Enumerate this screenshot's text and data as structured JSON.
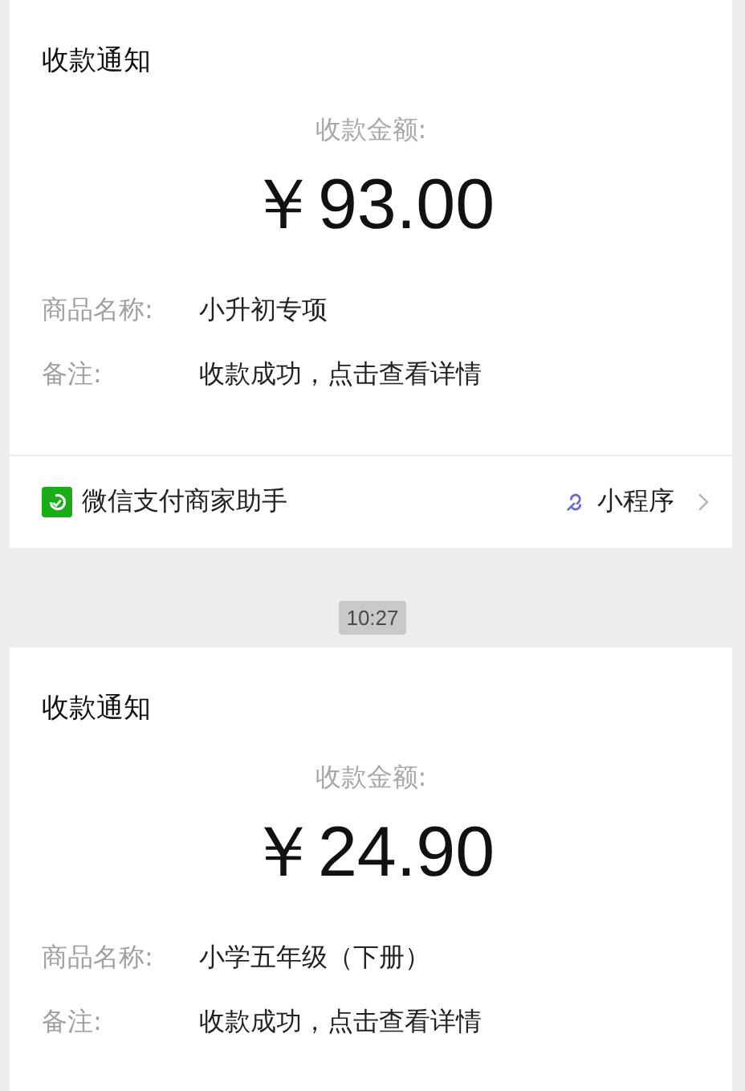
{
  "messages": [
    {
      "kind": "card",
      "title": "收款通知",
      "amount_label": "收款金额:",
      "amount": "￥93.00",
      "fields": [
        {
          "label": "商品名称:",
          "value": "小升初专项"
        },
        {
          "label": "备注:",
          "value": "收款成功，点击查看详情"
        }
      ],
      "footer": {
        "source": "微信支付商家助手",
        "link": "小程序"
      }
    },
    {
      "kind": "time",
      "text": "10:27"
    },
    {
      "kind": "card",
      "title": "收款通知",
      "amount_label": "收款金额:",
      "amount": "￥24.90",
      "fields": [
        {
          "label": "商品名称:",
          "value": "小学五年级（下册）"
        },
        {
          "label": "备注:",
          "value": "收款成功，点击查看详情"
        }
      ]
    }
  ]
}
